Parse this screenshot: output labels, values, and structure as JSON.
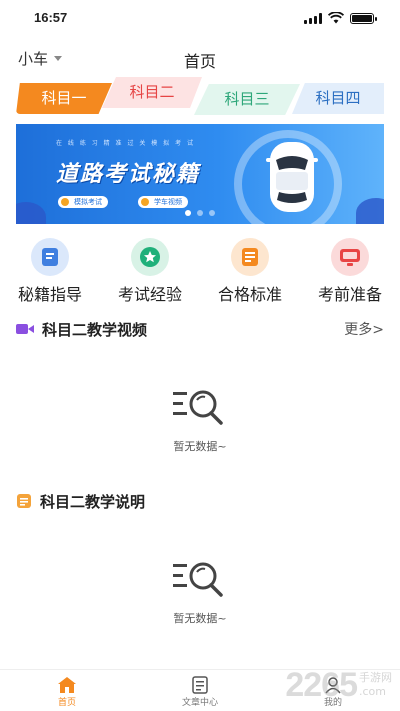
{
  "status_bar": {
    "time": "16:57",
    "battery_level": 1.0
  },
  "header": {
    "vehicle_label": "小车",
    "title": "首页"
  },
  "subject_tabs": [
    {
      "label": "科目一",
      "active": true
    },
    {
      "label": "科目二"
    },
    {
      "label": "科目三"
    },
    {
      "label": "科目四"
    }
  ],
  "banner": {
    "tag_line": "在 线 练 习   精 准 过 关   模 拟 考 试",
    "headline": "道路考试秘籍",
    "pill_1": "模拟考试",
    "pill_2": "学车视频",
    "dots": 3,
    "active_dot": 1
  },
  "quick_links": [
    {
      "label": "秘籍指导",
      "icon": "book-icon",
      "color": "#3f7fe0"
    },
    {
      "label": "考试经验",
      "icon": "star-badge-icon",
      "color": "#1fb07a"
    },
    {
      "label": "合格标准",
      "icon": "document-icon",
      "color": "#f4891f"
    },
    {
      "label": "考前准备",
      "icon": "monitor-icon",
      "color": "#e84545"
    }
  ],
  "video_section": {
    "title": "科目二教学视频",
    "more": "更多>",
    "empty_text": "暂无数据~"
  },
  "guide_section": {
    "title": "科目二教学说明",
    "empty_text": "暂无数据~"
  },
  "tab_bar": [
    {
      "label": "首页",
      "active": true
    },
    {
      "label": "文章中心"
    },
    {
      "label": "我的"
    }
  ],
  "watermark": {
    "number": "2265",
    "side_text": "手游网",
    "domain": ".com"
  },
  "colors": {
    "accent": "#f4891f",
    "banner_blue": "#1e6fd9"
  }
}
